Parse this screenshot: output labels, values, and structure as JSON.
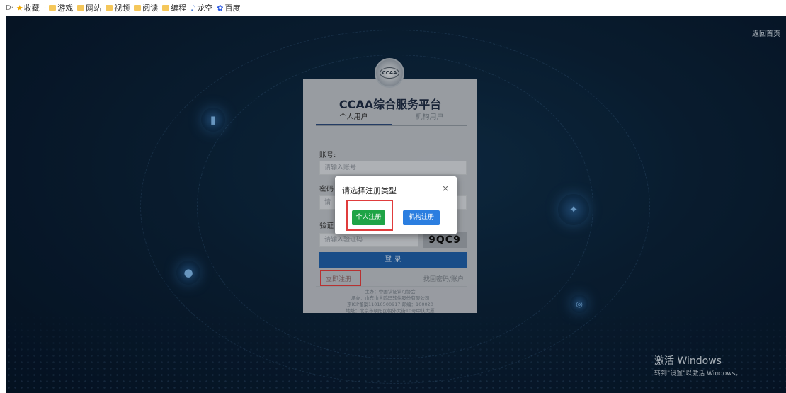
{
  "bookmarks": {
    "arrow": "D·",
    "items": [
      {
        "label": "收藏",
        "icon": "star-icon"
      },
      {
        "label": "游戏",
        "icon": "folder-icon"
      },
      {
        "label": "网站",
        "icon": "folder-icon"
      },
      {
        "label": "视频",
        "icon": "folder-icon"
      },
      {
        "label": "阅读",
        "icon": "folder-icon"
      },
      {
        "label": "编程",
        "icon": "folder-icon"
      },
      {
        "label": "龙空",
        "icon": "site-icon"
      },
      {
        "label": "百度",
        "icon": "baidu-icon"
      }
    ]
  },
  "header": {
    "return_home": "返回首页"
  },
  "login": {
    "emblem_text": "CCAA",
    "title": "CCAA综合服务平台",
    "tabs": [
      "个人用户",
      "机构用户"
    ],
    "account_label": "账号:",
    "account_placeholder": "请输入账号",
    "password_label": "密码",
    "password_placeholder": "请",
    "captcha_label": "验证",
    "captcha_placeholder": "请输入验证码",
    "captcha_code": "9QC9",
    "login_button": "登 录",
    "register_link": "立即注册",
    "find_password": "找回密码/账户",
    "footer": [
      "主办：中国认证认可协会",
      "承办：山东山大鸥玛软件股份有限公司",
      "京ICP备案11010500917 邮编：100020",
      "地址：北京市朝阳区朝外大街10号中认大厦"
    ]
  },
  "modal": {
    "title": "请选择注册类型",
    "close": "×",
    "personal_button": "个人注册",
    "org_button": "机构注册"
  },
  "watermark": {
    "line1": "激活 Windows",
    "line2": "转到\"设置\"以激活 Windows。"
  },
  "colors": {
    "background": "#0b2238",
    "personal_button": "#1ea446",
    "org_button": "#2b7ee0",
    "login_button": "#1f5fa6",
    "highlight": "#e03c3c"
  }
}
